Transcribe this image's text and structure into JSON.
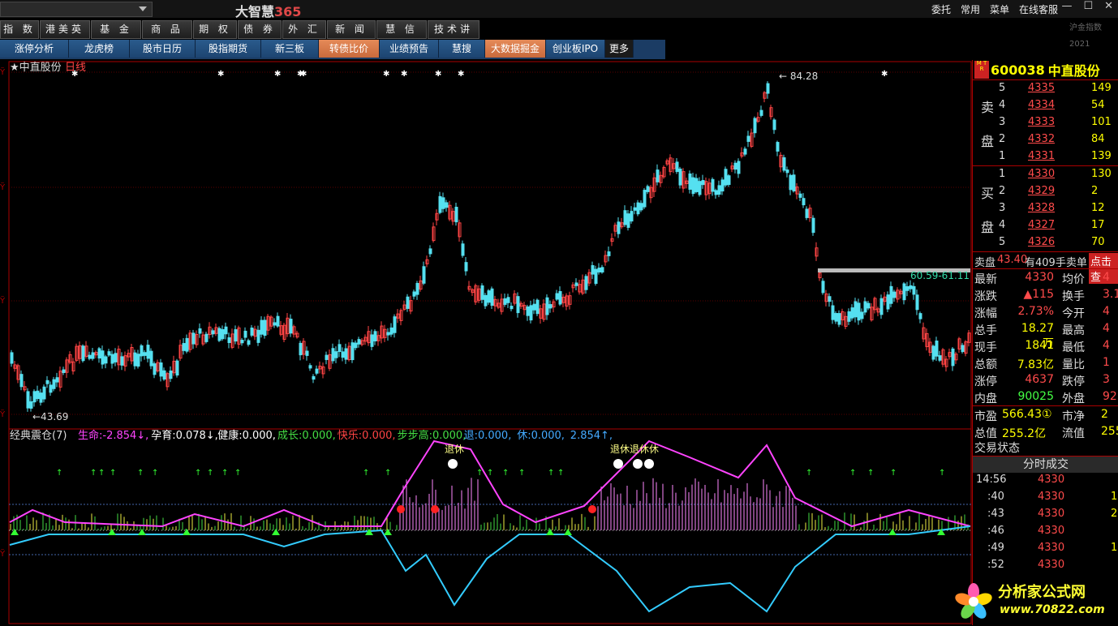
{
  "app": {
    "brand_text": "大智慧",
    "brand_num": "365"
  },
  "top_menu": [
    "委托",
    "常用",
    "菜单",
    "在线客服"
  ],
  "nav1": [
    "指 数",
    "港美英",
    "基 金",
    "商 品",
    "期 权",
    "债 券",
    "外 汇",
    "新 闻",
    "慧 信",
    "技术讲堂"
  ],
  "nav2": [
    {
      "label": "涨停分析",
      "highlight": false
    },
    {
      "label": "龙虎榜",
      "highlight": false
    },
    {
      "label": "股市日历",
      "highlight": false
    },
    {
      "label": "股指期货",
      "highlight": false
    },
    {
      "label": "新三板",
      "highlight": false
    },
    {
      "label": "转债比价",
      "highlight": true
    },
    {
      "label": "业绩预告",
      "highlight": false
    },
    {
      "label": "慧搜",
      "highlight": false
    },
    {
      "label": "大数据掘金",
      "highlight": true
    },
    {
      "label": "创业板IPO",
      "highlight": false
    },
    {
      "label": "更多",
      "highlight": false
    }
  ],
  "right_cut_text": "沪金指数 2021",
  "chart": {
    "title_prefix": "★中直股份",
    "title_period": "日线",
    "high_label": "84.28",
    "low_label": "43.69",
    "range_label": "60.59-61.11",
    "ind_name": "经典震仓(7)",
    "ind_values": [
      {
        "label": "生命:",
        "value": "-2.854",
        "arrow": "↓",
        "color": "#ff44ff"
      },
      {
        "label": "孕育:",
        "value": "0.078",
        "arrow": "↓",
        "color": "#ffffff"
      },
      {
        "label": "健康:",
        "value": "0.000",
        "arrow": "",
        "color": "#ffffff"
      },
      {
        "label": "成长:",
        "value": "0.000",
        "arrow": "",
        "color": "#44dd44"
      },
      {
        "label": "快乐:",
        "value": "0.000",
        "arrow": "",
        "color": "#ff4444"
      },
      {
        "label": "步步高:",
        "value": "0.000",
        "arrow": "",
        "color": "#44dd44"
      },
      {
        "label": "退:",
        "value": "0.000",
        "arrow": "",
        "color": "#44aaff"
      },
      {
        "label": "休:",
        "value": "0.000",
        "arrow": "",
        "color": "#44aaff"
      },
      {
        "label": "",
        "value": "2.854",
        "arrow": "↑",
        "color": "#44aaff"
      }
    ],
    "ind_note1": "退休",
    "ind_note2": "退休退休休",
    "y_tick_labels": [
      "Ϋ",
      "Ϋ",
      "Ϋ",
      "Ϋ",
      "Ϋ"
    ]
  },
  "quote": {
    "mtr": "M T R",
    "code": "600038",
    "name": "中直股份",
    "sell_label": "卖盘",
    "buy_label": "买盘",
    "asks": [
      {
        "n": "5",
        "price": "4335",
        "vol": "149"
      },
      {
        "n": "4",
        "price": "4334",
        "vol": "54"
      },
      {
        "n": "3",
        "price": "4333",
        "vol": "101"
      },
      {
        "n": "2",
        "price": "4332",
        "vol": "84"
      },
      {
        "n": "1",
        "price": "4331",
        "vol": "139"
      }
    ],
    "bids": [
      {
        "n": "1",
        "price": "4330",
        "vol": "130"
      },
      {
        "n": "2",
        "price": "4329",
        "vol": "2"
      },
      {
        "n": "3",
        "price": "4328",
        "vol": "12"
      },
      {
        "n": "4",
        "price": "4327",
        "vol": "17"
      },
      {
        "n": "5",
        "price": "4326",
        "vol": "70"
      }
    ],
    "sell_bar": {
      "a": "卖盘",
      "b": "43.40",
      "c": "有409手卖单",
      "btn": "点击查"
    },
    "stats": [
      {
        "k1": "最新",
        "v1": "4330",
        "c1": "#ff4b4b",
        "k2": "均价",
        "v2": "4"
      },
      {
        "k1": "涨跌",
        "v1": "▲115",
        "c1": "#ff4b4b",
        "k2": "换手",
        "v2": "3.1"
      },
      {
        "k1": "涨幅",
        "v1": "2.73%",
        "c1": "#ff4b4b",
        "k2": "今开",
        "v2": "4"
      },
      {
        "k1": "总手",
        "v1": "18.27万",
        "c1": "#ffff00",
        "k2": "最高",
        "v2": "4"
      },
      {
        "k1": "现手",
        "v1": "1841",
        "c1": "#ffff00",
        "k2": "最低",
        "v2": "4"
      },
      {
        "k1": "总额",
        "v1": "7.83亿",
        "c1": "#ffff00",
        "k2": "量比",
        "v2": "1"
      },
      {
        "k1": "涨停",
        "v1": "4637",
        "c1": "#ff4b4b",
        "k2": "跌停",
        "v2": "3"
      },
      {
        "k1": "内盘",
        "v1": "90025",
        "c1": "#44ff44",
        "k2": "外盘",
        "v2": "92"
      }
    ],
    "market": [
      {
        "k1": "市盈",
        "v1": "566.43①",
        "k2": "市净",
        "v2": "2"
      },
      {
        "k1": "总值",
        "v1": "255.2亿",
        "k2": "流值",
        "v2": "255."
      }
    ],
    "trade_state": "交易状态",
    "ticks_title": "分时成交",
    "ticks": [
      {
        "t": "14:56",
        "p": "4330",
        "v": ""
      },
      {
        "t": ":40",
        "p": "4330",
        "v": "1"
      },
      {
        "t": ":43",
        "p": "4330",
        "v": "2"
      },
      {
        "t": ":46",
        "p": "4330",
        "v": ""
      },
      {
        "t": ":49",
        "p": "4330",
        "v": "1"
      },
      {
        "t": ":52",
        "p": "4330",
        "v": ""
      }
    ]
  },
  "watermark": {
    "line1": "分析家公式网",
    "line2": "www.70822.com"
  }
}
